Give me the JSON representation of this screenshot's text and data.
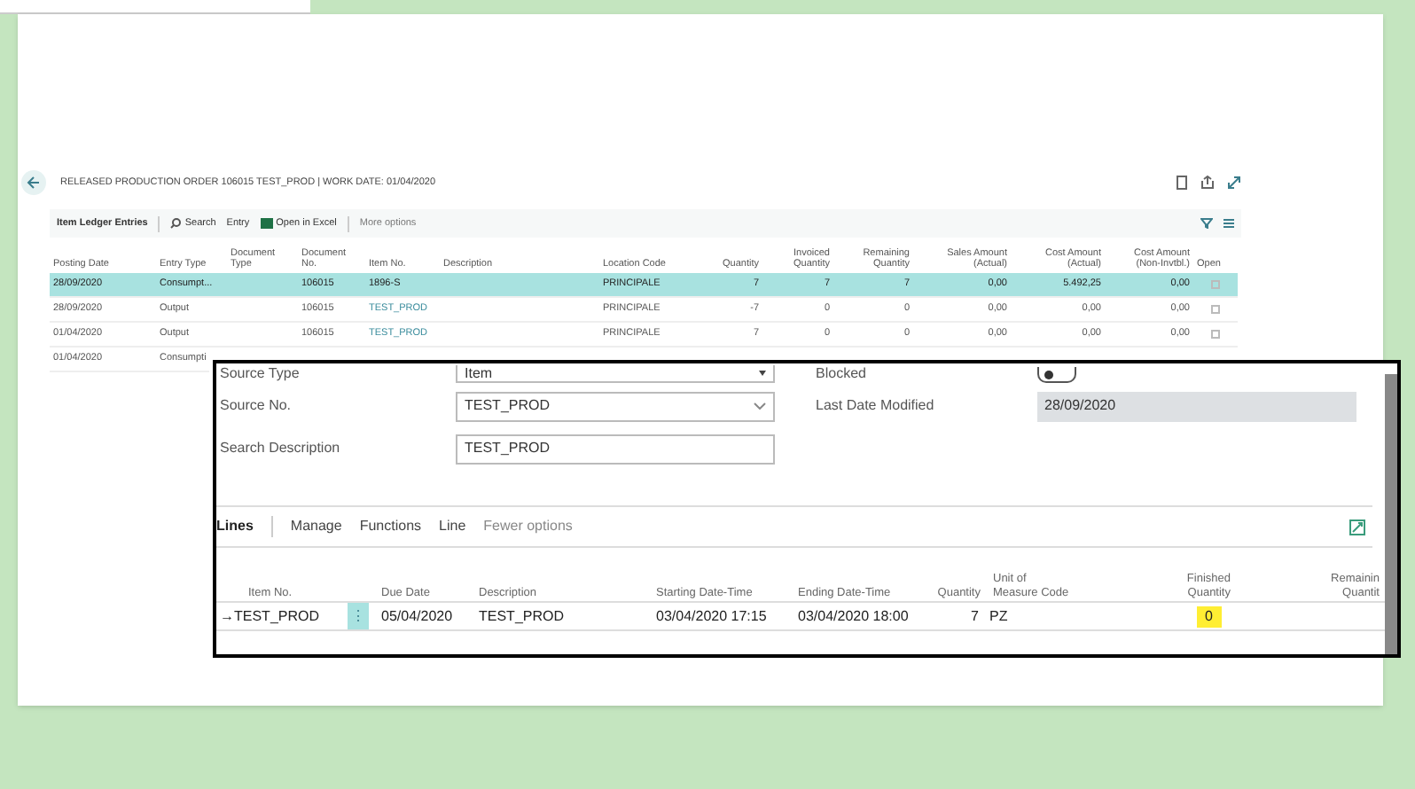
{
  "page": {
    "title": "RELEASED PRODUCTION ORDER 106015 TEST_PROD | WORK DATE: 01/04/2020"
  },
  "toolbar": {
    "tab": "Item Ledger Entries",
    "search": "Search",
    "entry": "Entry",
    "excel": "Open in Excel",
    "more": "More options"
  },
  "ledger": {
    "columns": [
      "Posting Date",
      "Entry Type",
      "Document Type",
      "Document No.",
      "Item No.",
      "Description",
      "Location Code",
      "Quantity",
      "Invoiced Quantity",
      "Remaining Quantity",
      "Sales Amount (Actual)",
      "Cost Amount (Actual)",
      "Cost Amount (Non-Invtbl.)",
      "Open"
    ],
    "rows": [
      {
        "selected": true,
        "open": false,
        "cells": [
          "28/09/2020",
          "Consumpt...",
          "",
          "106015",
          "1896-S",
          "",
          "PRINCIPALE",
          "7",
          "7",
          "7",
          "0,00",
          "5.492,25",
          "0,00"
        ]
      },
      {
        "selected": false,
        "open": false,
        "cells": [
          "28/09/2020",
          "Output",
          "",
          "106015",
          "TEST_PROD",
          "",
          "PRINCIPALE",
          "-7",
          "0",
          "0",
          "0,00",
          "0,00",
          "0,00"
        ]
      },
      {
        "selected": false,
        "open": false,
        "cells": [
          "01/04/2020",
          "Output",
          "",
          "106015",
          "TEST_PROD",
          "",
          "PRINCIPALE",
          "7",
          "0",
          "0",
          "0,00",
          "0,00",
          "0,00"
        ]
      },
      {
        "selected": false,
        "cells": [
          "01/04/2020",
          "Consumpti"
        ]
      }
    ]
  },
  "order": {
    "fields": [
      {
        "label": "Source Type",
        "value": "Item",
        "kind": "select"
      },
      {
        "label": "Source No.",
        "value": "TEST_PROD",
        "kind": "dropdown"
      },
      {
        "label": "Search Description",
        "value": "TEST_PROD",
        "kind": "text"
      }
    ],
    "side_fields": [
      {
        "label": "Blocked",
        "kind": "toggle",
        "on": false
      },
      {
        "label": "Last Date Modified",
        "value": "28/09/2020",
        "kind": "readonly"
      }
    ],
    "lines_tabs": [
      {
        "label": "Lines",
        "selected": true
      },
      {
        "label": "Manage",
        "selected": false
      },
      {
        "label": "Functions",
        "selected": false
      },
      {
        "label": "Line",
        "selected": false
      },
      {
        "label": "Fewer options",
        "selected": false
      }
    ],
    "columns": [
      "Item No.",
      "Due Date",
      "Description",
      "Starting Date-Time",
      "Ending Date-Time",
      "Quantity",
      "Unit of Measure Code",
      "Finished Quantity",
      "Remainin Quantit"
    ],
    "rows": [
      {
        "marker": "→",
        "menu": "⋮",
        "cells": [
          "TEST_PROD",
          "05/04/2020",
          "TEST_PROD",
          "03/04/2020 17:15",
          "03/04/2020 18:00",
          "7",
          "PZ",
          "0",
          ""
        ],
        "highlight": true
      }
    ]
  }
}
